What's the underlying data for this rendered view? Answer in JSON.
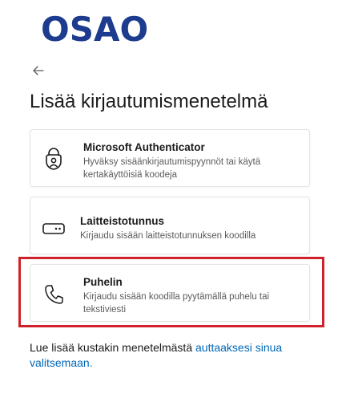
{
  "brand": {
    "logo_text": "OSAO",
    "logo_color": "#1d3c8f"
  },
  "navigation": {
    "back_icon": "arrow-left-icon"
  },
  "page": {
    "title": "Lisää kirjautumismenetelmä"
  },
  "methods": [
    {
      "icon": "authenticator-lock-icon",
      "title": "Microsoft Authenticator",
      "description": "Hyväksy sisäänkirjautumispyynnöt tai käytä kertakäyttöisiä koodeja"
    },
    {
      "icon": "passkey-device-icon",
      "title": "Laitteistotunnus",
      "description": "Kirjaudu sisään laitteistotunnuksen koodilla"
    },
    {
      "icon": "phone-icon",
      "title": "Puhelin",
      "description": "Kirjaudu sisään koodilla pyytämällä puhelu tai tekstiviesti",
      "highlighted": true
    }
  ],
  "highlight_color": "#d0202a",
  "footer": {
    "text": "Lue lisää kustakin menetelmästä ",
    "link_text": "auttaaksesi sinua valitsemaan.",
    "link_color": "#0067b8"
  }
}
